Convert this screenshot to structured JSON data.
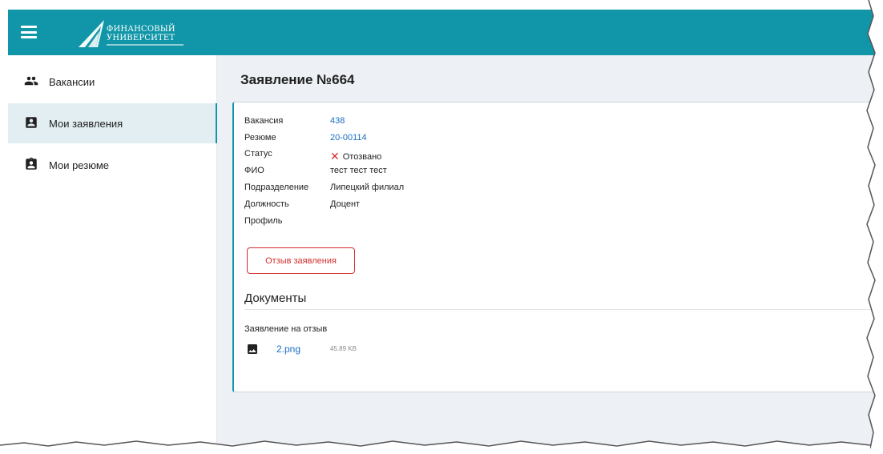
{
  "header": {
    "logo_line1": "ФИНАНСОВЫЙ",
    "logo_line2": "УНИВЕРСИТЕТ",
    "bar_color": "#1096a8"
  },
  "sidebar": {
    "items": [
      {
        "label": "Вакансии",
        "icon": "people-icon",
        "active": false
      },
      {
        "label": "Мои заявления",
        "icon": "account-box-icon",
        "active": true
      },
      {
        "label": "Мои резюме",
        "icon": "clipboard-account-icon",
        "active": false
      }
    ]
  },
  "main": {
    "title": "Заявление №664",
    "fields": [
      {
        "label": "Вакансия",
        "value": "438",
        "link": true
      },
      {
        "label": "Резюме",
        "value": "20-00114",
        "link": true
      },
      {
        "label": "Статус",
        "value": "Отозвано",
        "status_icon": "close-icon"
      },
      {
        "label": "ФИО",
        "value": "тест тест тест"
      },
      {
        "label": "Подразделение",
        "value": "Липецкий филиал"
      },
      {
        "label": "Должность",
        "value": "Доцент"
      },
      {
        "label": "Профиль",
        "value": ""
      }
    ],
    "withdraw_button": "Отзыв заявления",
    "documents": {
      "title": "Документы",
      "caption": "Заявление на отзыв",
      "file": {
        "name": "2.png",
        "size": "45.89 KB",
        "icon": "image-icon"
      }
    }
  },
  "colors": {
    "accent": "#1096a8",
    "link": "#1a6fc2",
    "danger": "#d32f2f",
    "main_bg": "#edf0f5",
    "active_nav_bg": "#e2eef1"
  }
}
